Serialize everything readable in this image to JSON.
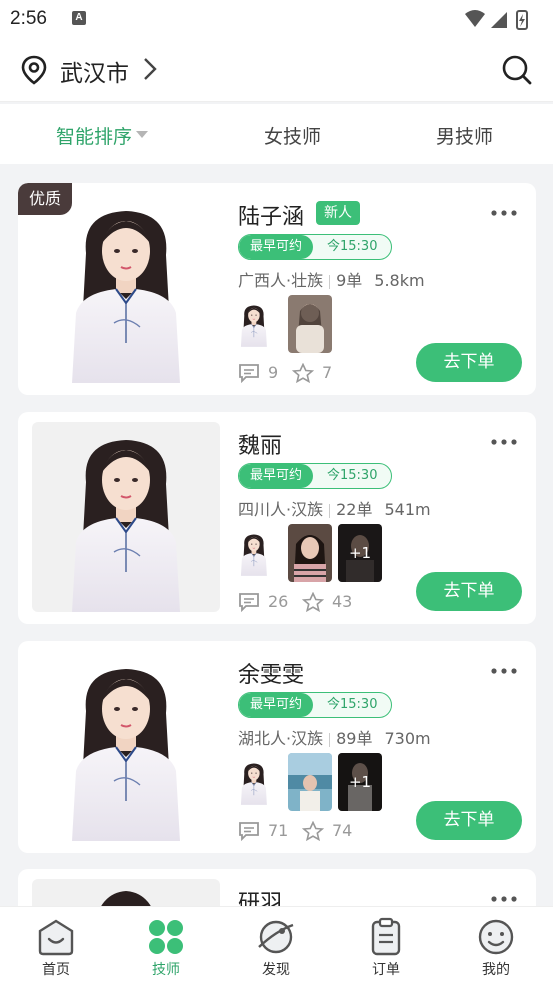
{
  "status_bar": {
    "time": "2:56",
    "notif_letter": "A"
  },
  "header": {
    "city": "武汉市",
    "icons": [
      "location-pin-icon",
      "chevron-right-icon",
      "search-icon"
    ]
  },
  "tabs": [
    {
      "label": "智能排序",
      "active": true
    },
    {
      "label": "女技师",
      "active": false
    },
    {
      "label": "男技师",
      "active": false
    }
  ],
  "therapists": [
    {
      "name": "陆子涵",
      "badge": "优质",
      "new_tag": "新人",
      "avail_label": "最早可约",
      "avail_time": "今15:30",
      "origin": "广西人·壮族",
      "orders": "9单",
      "distance": "5.8km",
      "thumb_extra": "",
      "comments": "9",
      "favorites": "7",
      "button": "去下单"
    },
    {
      "name": "魏丽",
      "badge": "",
      "new_tag": "",
      "avail_label": "最早可约",
      "avail_time": "今15:30",
      "origin": "四川人·汉族",
      "orders": "22单",
      "distance": "541m",
      "thumb_extra": "+1",
      "comments": "26",
      "favorites": "43",
      "button": "去下单"
    },
    {
      "name": "余雯雯",
      "badge": "",
      "new_tag": "",
      "avail_label": "最早可约",
      "avail_time": "今15:30",
      "origin": "湖北人·汉族",
      "orders": "89单",
      "distance": "730m",
      "thumb_extra": "+1",
      "comments": "71",
      "favorites": "74",
      "button": "去下单"
    },
    {
      "name": "研羽"
    }
  ],
  "bottom_nav": [
    {
      "label": "首页",
      "icon": "home-icon",
      "active": false
    },
    {
      "label": "技师",
      "icon": "therapist-grid-icon",
      "active": true
    },
    {
      "label": "发现",
      "icon": "discover-planet-icon",
      "active": false
    },
    {
      "label": "订单",
      "icon": "order-clipboard-icon",
      "active": false
    },
    {
      "label": "我的",
      "icon": "profile-smiley-icon",
      "active": false
    }
  ],
  "colors": {
    "accent": "#3cbf78",
    "accent_text": "#2fa46a",
    "badge_dark": "#4a3b3b",
    "background": "#f2f3f5"
  }
}
